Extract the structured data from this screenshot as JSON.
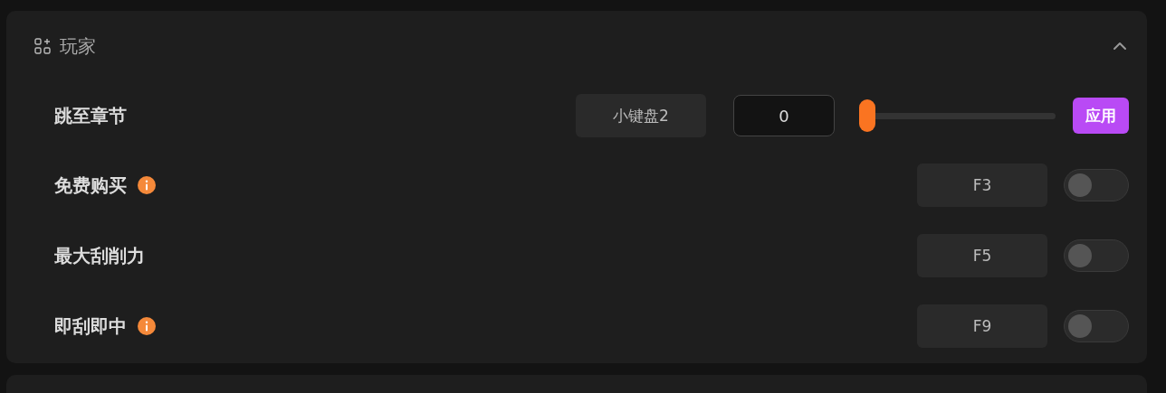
{
  "section": {
    "title": "玩家",
    "expanded": true
  },
  "rows": [
    {
      "kind": "slider",
      "label": "跳至章节",
      "info": false,
      "hotkey": "小键盘2",
      "value": "0",
      "level": 0,
      "button": "应用"
    },
    {
      "kind": "toggle",
      "label": "免费购买",
      "info": true,
      "hotkey": "F3",
      "on": false
    },
    {
      "kind": "toggle",
      "label": "最大刮削力",
      "info": false,
      "hotkey": "F5",
      "on": false
    },
    {
      "kind": "toggle",
      "label": "即刮即中",
      "info": true,
      "hotkey": "F9",
      "on": false
    }
  ]
}
